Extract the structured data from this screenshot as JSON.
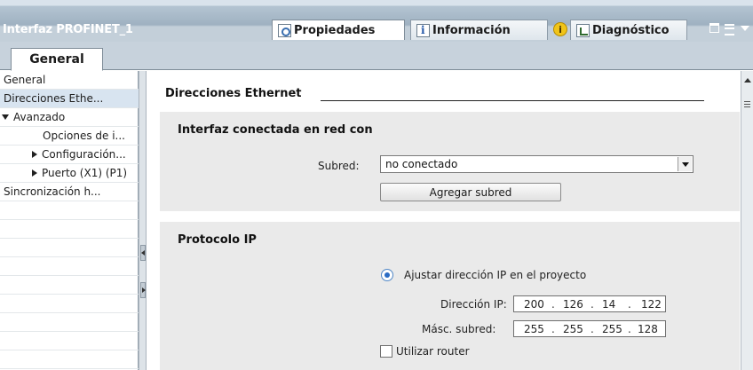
{
  "window": {
    "title": "Interfaz PROFINET_1",
    "tabs": [
      {
        "label": "Propiedades",
        "icon": "properties-icon",
        "active": true
      },
      {
        "label": "Información",
        "icon": "info-icon",
        "active": false
      },
      {
        "label": "Diagnóstico",
        "icon": "diagnostics-icon",
        "active": false
      }
    ],
    "warning_badge": "i"
  },
  "subtabs": [
    {
      "label": "General",
      "active": true
    }
  ],
  "sidebar": {
    "items": [
      {
        "label": "General",
        "indent": 0,
        "expander": "none",
        "selected": false
      },
      {
        "label": "Direcciones Ethe...",
        "indent": 0,
        "expander": "none",
        "selected": true
      },
      {
        "label": "Avanzado",
        "indent": 0,
        "expander": "expanded",
        "selected": false
      },
      {
        "label": "Opciones de i...",
        "indent": 2,
        "expander": "none",
        "selected": false
      },
      {
        "label": "Configuración...",
        "indent": 1,
        "expander": "collapsed",
        "selected": false
      },
      {
        "label": "Puerto (X1) (P1)",
        "indent": 1,
        "expander": "collapsed",
        "selected": false
      },
      {
        "label": "Sincronización h...",
        "indent": 0,
        "expander": "none",
        "selected": false
      }
    ]
  },
  "main": {
    "section_title": "Direcciones Ethernet",
    "network_panel": {
      "title": "Interfaz conectada en red con",
      "subnet_label": "Subred:",
      "subnet_value": "no conectado",
      "add_subnet_button": "Agregar subred"
    },
    "ip_panel": {
      "title": "Protocolo IP",
      "radio_label": "Ajustar dirección IP en el proyecto",
      "radio_selected": true,
      "ip_label": "Dirección IP:",
      "ip_octets": [
        "200",
        "126",
        "14",
        "122"
      ],
      "mask_label": "Másc. subred:",
      "mask_octets": [
        "255",
        "255",
        "255",
        "128"
      ],
      "router_label": "Utilizar router",
      "router_checked": false
    }
  },
  "colors": {
    "accent_blue": "#2b6cc4",
    "panel_bg": "#eaeaea",
    "titlebar": "#9fb1c1",
    "selected_row": "#d8e4f0",
    "warning": "#f0c419"
  }
}
